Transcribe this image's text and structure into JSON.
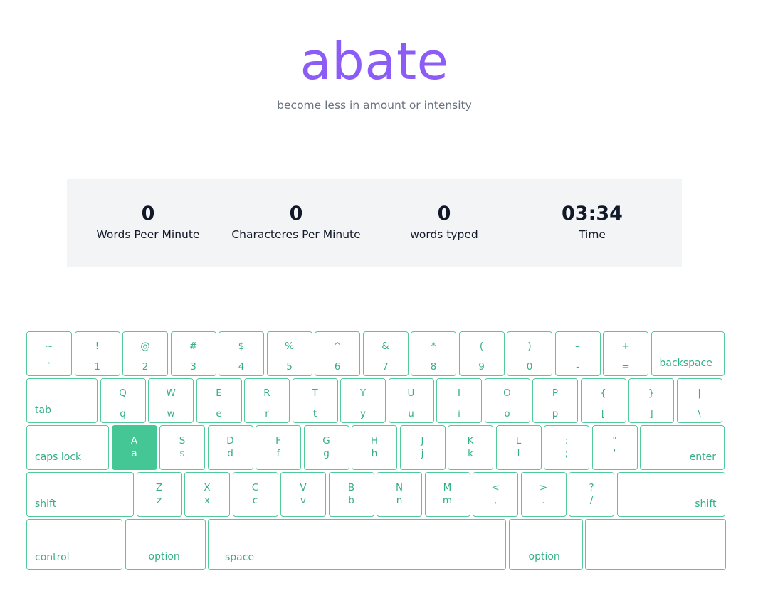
{
  "word": "abate",
  "definition": "become less in amount or intensity",
  "stats": [
    {
      "value": "0",
      "label": "Words Peer Minute"
    },
    {
      "value": "0",
      "label": "Characteres Per Minute"
    },
    {
      "value": "0",
      "label": "words typed"
    },
    {
      "value": "03:34",
      "label": "Time"
    }
  ],
  "colors": {
    "accent": "#8b5cf6",
    "key": "#34b085",
    "active_key": "#44c794"
  },
  "keyboard": {
    "row1": [
      {
        "top": "~",
        "bot": "`"
      },
      {
        "top": "!",
        "bot": "1"
      },
      {
        "top": "@",
        "bot": "2"
      },
      {
        "top": "#",
        "bot": "3"
      },
      {
        "top": "$",
        "bot": "4"
      },
      {
        "top": "%",
        "bot": "5"
      },
      {
        "top": "^",
        "bot": "6"
      },
      {
        "top": "&",
        "bot": "7"
      },
      {
        "top": "*",
        "bot": "8"
      },
      {
        "top": "(",
        "bot": "9"
      },
      {
        "top": ")",
        "bot": "0"
      },
      {
        "top": "–",
        "bot": "-"
      },
      {
        "top": "+",
        "bot": "="
      }
    ],
    "backspace": "backspace",
    "tab": "tab",
    "row2": [
      {
        "top": "Q",
        "bot": "q"
      },
      {
        "top": "W",
        "bot": "w"
      },
      {
        "top": "E",
        "bot": "e"
      },
      {
        "top": "R",
        "bot": "r"
      },
      {
        "top": "T",
        "bot": "t"
      },
      {
        "top": "Y",
        "bot": "y"
      },
      {
        "top": "U",
        "bot": "u"
      },
      {
        "top": "I",
        "bot": "i"
      },
      {
        "top": "O",
        "bot": "o"
      },
      {
        "top": "P",
        "bot": "p"
      },
      {
        "top": "{",
        "bot": "["
      },
      {
        "top": "}",
        "bot": "]"
      },
      {
        "top": "|",
        "bot": "\\"
      }
    ],
    "caps": "caps lock",
    "row3": [
      {
        "top": "A",
        "bot": "a"
      },
      {
        "top": "S",
        "bot": "s"
      },
      {
        "top": "D",
        "bot": "d"
      },
      {
        "top": "F",
        "bot": "f"
      },
      {
        "top": "G",
        "bot": "g"
      },
      {
        "top": "H",
        "bot": "h"
      },
      {
        "top": "J",
        "bot": "j"
      },
      {
        "top": "K",
        "bot": "k"
      },
      {
        "top": "L",
        "bot": "l"
      },
      {
        "top": ":",
        "bot": ";"
      },
      {
        "top": "\"",
        "bot": "'"
      }
    ],
    "enter": "enter",
    "shift": "shift",
    "row4": [
      {
        "top": "Z",
        "bot": "z"
      },
      {
        "top": "X",
        "bot": "x"
      },
      {
        "top": "C",
        "bot": "c"
      },
      {
        "top": "V",
        "bot": "v"
      },
      {
        "top": "B",
        "bot": "b"
      },
      {
        "top": "N",
        "bot": "n"
      },
      {
        "top": "M",
        "bot": "m"
      },
      {
        "top": "<",
        "bot": ","
      },
      {
        "top": ">",
        "bot": "."
      },
      {
        "top": "?",
        "bot": "/"
      }
    ],
    "shift_right": "shift",
    "control": "control",
    "option_left": "option",
    "space": "space",
    "option_right": "option",
    "active_key": "a"
  }
}
